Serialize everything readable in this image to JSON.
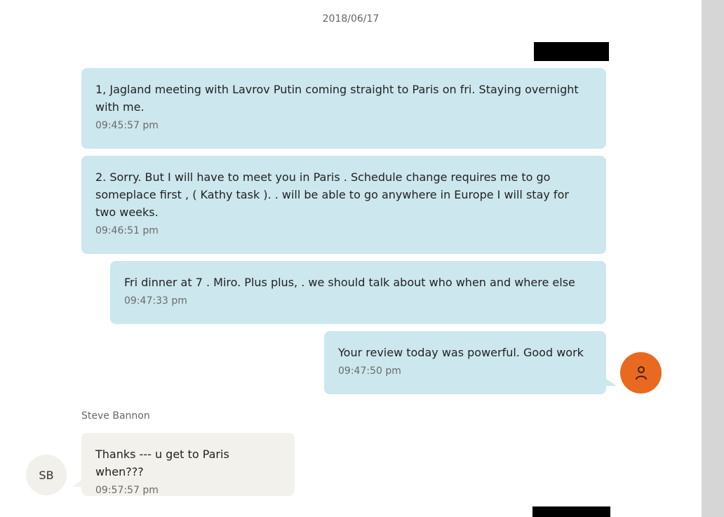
{
  "conversation": {
    "date": "2018/06/17",
    "messages": [
      {
        "text": "1,  Jagland meeting with Lavrov Putin coming straight to Paris on fri.  Staying overnight with me.",
        "time": "09:45:57 pm"
      },
      {
        "text": "2. Sorry. But I will have to meet you in Paris .  Schedule change requires me to go someplace first , ( Kathy task ). . will be able to go anywhere in Europe I will stay for two weeks.",
        "time": "09:46:51 pm"
      },
      {
        "text": "Fri dinner at 7 .  Miro. Plus plus, .   we should talk about who when and where else",
        "time": "09:47:33 pm"
      },
      {
        "text": "Your review today was powerful.  Good work",
        "time": "09:47:50 pm"
      },
      {
        "sender": "Steve Bannon",
        "text": "Thanks --- u get to Paris when???",
        "time": "09:57:57 pm",
        "avatar_initials": "SB"
      }
    ],
    "self_avatar_icon": "person-icon",
    "colors": {
      "outgoing": "#cce7ee",
      "incoming": "#f2f1ec",
      "avatar": "#e8691f"
    }
  }
}
